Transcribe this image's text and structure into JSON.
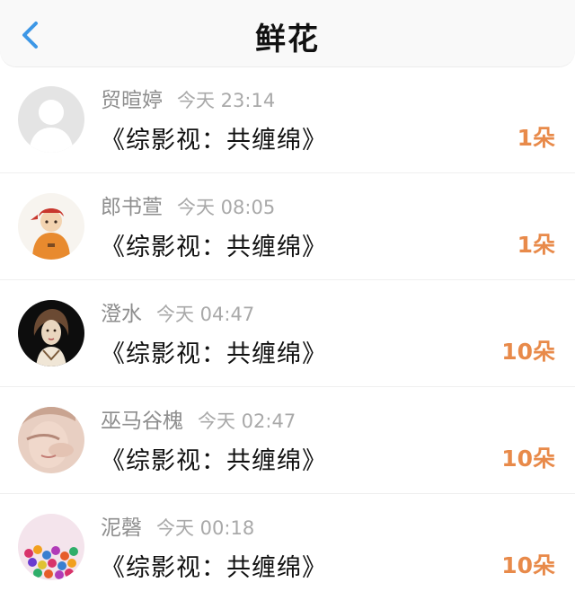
{
  "header": {
    "title": "鲜花",
    "back_icon": "chevron-left-icon",
    "accent": "#3d97e6"
  },
  "colors": {
    "amount": "#e88a4a",
    "name": "#8e8e8e",
    "time": "#a9a9a9"
  },
  "items": [
    {
      "name": "贸暄婷",
      "time": "今天 23:14",
      "content": "《综影视：共缠绵》",
      "amount": "1朵",
      "avatar": "default-user-avatar"
    },
    {
      "name": "郎书萱",
      "time": "今天 08:05",
      "content": "《综影视：共缠绵》",
      "amount": "1朵",
      "avatar": "cartoon-child-avatar"
    },
    {
      "name": "澄水",
      "time": "今天 04:47",
      "content": "《综影视：共缠绵》",
      "amount": "10朵",
      "avatar": "illustrated-woman-avatar"
    },
    {
      "name": "巫马谷槐",
      "time": "今天 02:47",
      "content": "《综影视：共缠绵》",
      "amount": "10朵",
      "avatar": "photo-face-avatar"
    },
    {
      "name": "泥磬",
      "time": "今天 00:18",
      "content": "《综影视：共缠绵》",
      "amount": "10朵",
      "avatar": "colorful-beads-avatar"
    }
  ]
}
